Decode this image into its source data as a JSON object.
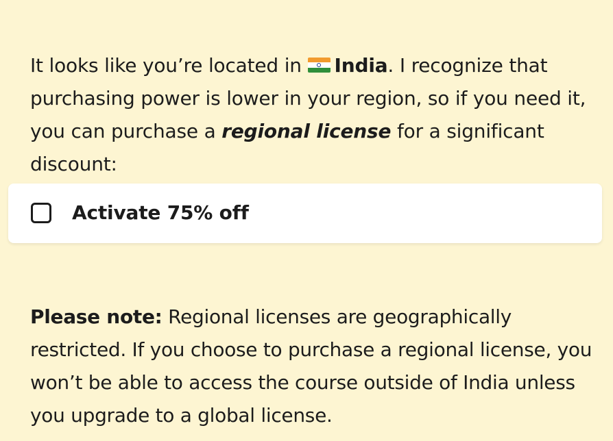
{
  "intro": {
    "prefix": "It looks like you’re located in",
    "country_flag": "india-flag",
    "country": "India",
    "sentence_1_end": ". I recognize that purchasing power is lower in your region, so if you need it, you can purchase a",
    "license_term": "regional license",
    "sentence_2_end": "for a significant discount:"
  },
  "offer": {
    "checked": false,
    "label": "Activate 75% off"
  },
  "note": {
    "lead": "Please note:",
    "body": "Regional licenses are geographically restricted. If you choose to purchase a regional license, you won’t be able to access the course outside of India unless you upgrade to a global license."
  },
  "colors": {
    "background": "#fdf5d2",
    "card": "#ffffff",
    "text": "#1c1c1c"
  }
}
